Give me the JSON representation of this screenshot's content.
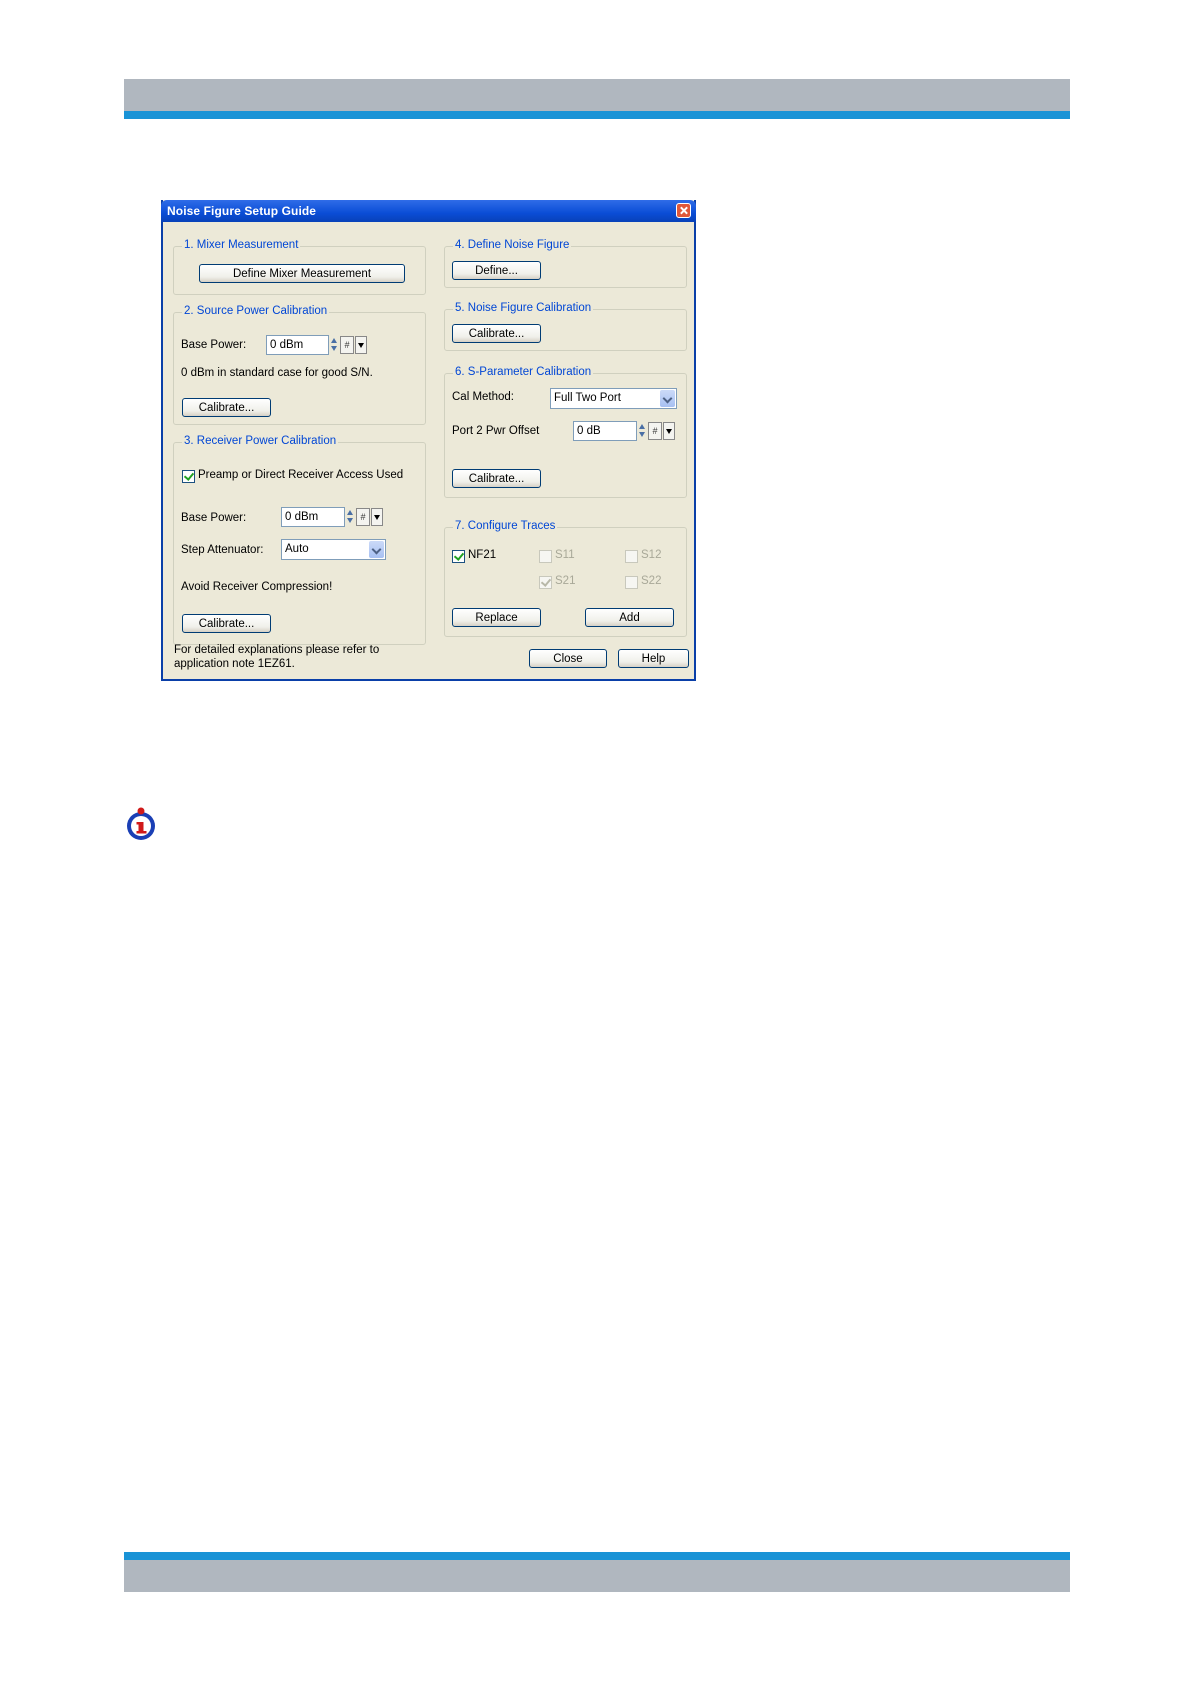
{
  "dialog": {
    "title": "Noise Figure Setup Guide",
    "groups": {
      "mixer": {
        "title": "1. Mixer Measurement",
        "define_button": "Define Mixer Measurement"
      },
      "source_power": {
        "title": "2. Source Power Calibration",
        "base_power_label": "Base Power:",
        "base_power_value": "0 dBm",
        "note": "0 dBm in standard case for good S/N.",
        "calibrate_button": "Calibrate..."
      },
      "receiver_power": {
        "title": "3. Receiver Power Calibration",
        "preamp_label": "Preamp or Direct Receiver Access Used",
        "preamp_checked": true,
        "base_power_label": "Base Power:",
        "base_power_value": "0 dBm",
        "step_attenuator_label": "Step Attenuator:",
        "step_attenuator_value": "Auto",
        "note": "Avoid Receiver Compression!",
        "calibrate_button": "Calibrate..."
      },
      "define_nf": {
        "title": "4. Define Noise Figure",
        "define_button": "Define..."
      },
      "nf_calibration": {
        "title": "5. Noise Figure Calibration",
        "calibrate_button": "Calibrate..."
      },
      "sparam_calibration": {
        "title": "6. S-Parameter Calibration",
        "cal_method_label": "Cal Method:",
        "cal_method_value": "Full Two Port",
        "port2_offset_label": "Port 2 Pwr Offset",
        "port2_offset_value": "0 dB",
        "calibrate_button": "Calibrate..."
      },
      "traces": {
        "title": "7. Configure Traces",
        "nf21": "NF21",
        "s11": "S11",
        "s12": "S12",
        "s21": "S21",
        "s22": "S22",
        "replace_button": "Replace",
        "add_button": "Add"
      }
    },
    "footer": {
      "note_line1": "For detailed explanations please refer to",
      "note_line2": "application note 1EZ61.",
      "close_button": "Close",
      "help_button": "Help"
    },
    "symbols": {
      "step_symbol": "#"
    }
  }
}
